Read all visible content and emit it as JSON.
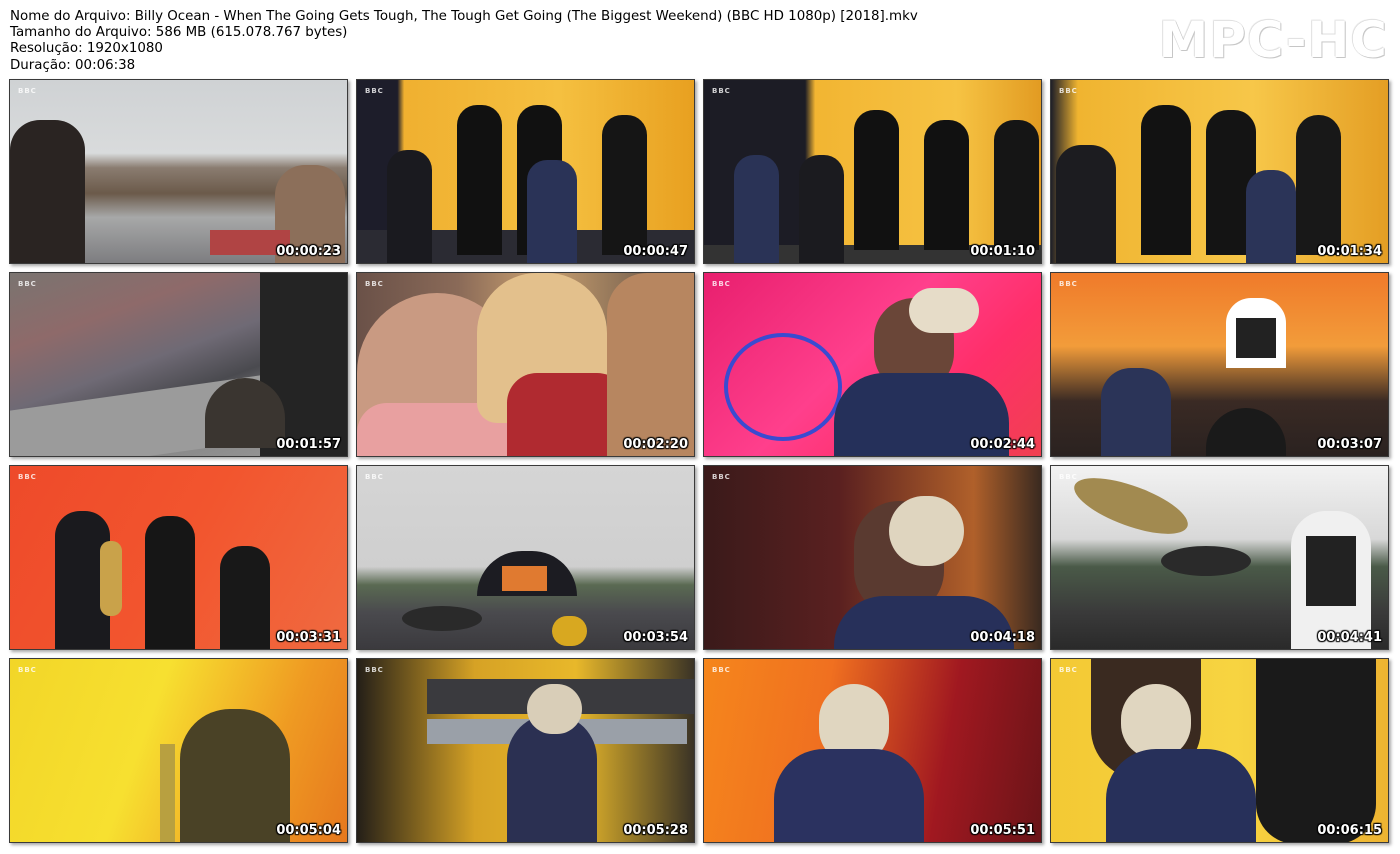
{
  "info": {
    "file_name": "Nome do Arquivo: Billy Ocean - When The Going Gets Tough, The Tough Get Going (The Biggest Weekend) (BBC HD 1080p) [2018].mkv",
    "file_size": "Tamanho do Arquivo: 586 MB (615.078.767 bytes)",
    "resolution": "Resolução: 1920x1080",
    "duration": "Duração: 00:06:38"
  },
  "logo": "MPC-HC",
  "network_mark": "BBC",
  "thumbnails": [
    {
      "timestamp": "00:00:23",
      "scene": "drummer-and-keyboard-on-stage"
    },
    {
      "timestamp": "00:00:47",
      "scene": "band-on-yellow-stage"
    },
    {
      "timestamp": "00:01:10",
      "scene": "band-on-yellow-stage"
    },
    {
      "timestamp": "00:01:34",
      "scene": "band-on-yellow-stage"
    },
    {
      "timestamp": "00:01:57",
      "scene": "crowd-and-stage-wide"
    },
    {
      "timestamp": "00:02:20",
      "scene": "audience-closeup"
    },
    {
      "timestamp": "00:02:44",
      "scene": "singer-closeup-pink"
    },
    {
      "timestamp": "00:03:07",
      "scene": "singer-and-drummer-orange"
    },
    {
      "timestamp": "00:03:31",
      "scene": "sax-and-backing-singers-red"
    },
    {
      "timestamp": "00:03:54",
      "scene": "festival-wide-shot-rain"
    },
    {
      "timestamp": "00:04:18",
      "scene": "singer-closeup-dark-red"
    },
    {
      "timestamp": "00:04:41",
      "scene": "drummer-closeup"
    },
    {
      "timestamp": "00:05:04",
      "scene": "singer-with-guitar-yellow"
    },
    {
      "timestamp": "00:05:28",
      "scene": "singer-by-keyboards"
    },
    {
      "timestamp": "00:05:51",
      "scene": "singer-closeup-orange"
    },
    {
      "timestamp": "00:06:15",
      "scene": "singer-with-dancers"
    }
  ]
}
